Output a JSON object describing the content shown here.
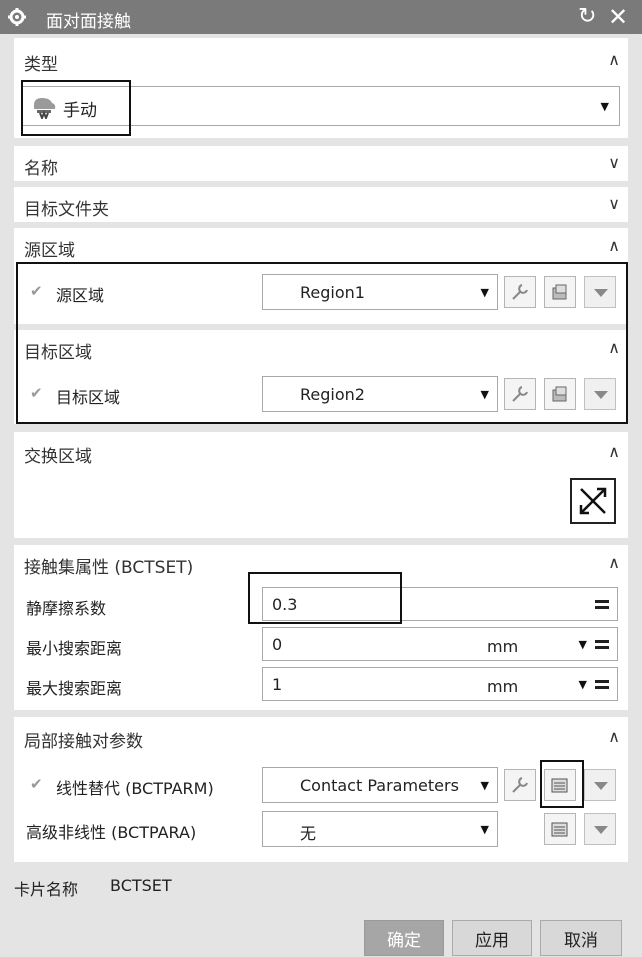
{
  "window": {
    "title": "面对面接触",
    "icon": "gear-icon"
  },
  "type_section": {
    "header": "类型",
    "selected": "手动",
    "icon": "manual-contact-icon"
  },
  "name_section": {
    "header": "名称"
  },
  "folder_section": {
    "header": "目标文件夹"
  },
  "source_section": {
    "header": "源区域",
    "row_label": "源区域",
    "value": "Region1"
  },
  "target_section": {
    "header": "目标区域",
    "row_label": "目标区域",
    "value": "Region2"
  },
  "swap_section": {
    "header": "交换区域"
  },
  "contact_set": {
    "header": "接触集属性 (BCTSET)",
    "static_friction": {
      "label": "静摩擦系数",
      "value": "0.3"
    },
    "min_search": {
      "label": "最小搜索距离",
      "value": "0",
      "unit": "mm"
    },
    "max_search": {
      "label": "最大搜索距离",
      "value": "1",
      "unit": "mm"
    }
  },
  "local_params": {
    "header": "局部接触对参数",
    "linear": {
      "label": "线性替代 (BCTPARM)",
      "value": "Contact Parameters"
    },
    "nonlinear": {
      "label": "高级非线性 (BCTPARA)",
      "value": "无"
    }
  },
  "card": {
    "label": "卡片名称",
    "value": "BCTSET"
  },
  "footer": {
    "ok": "确定",
    "apply": "应用",
    "cancel": "取消"
  },
  "colors": {
    "titlebar": "#7a7a7a",
    "panel": "#e4e4e4",
    "highlight": "#111111"
  }
}
